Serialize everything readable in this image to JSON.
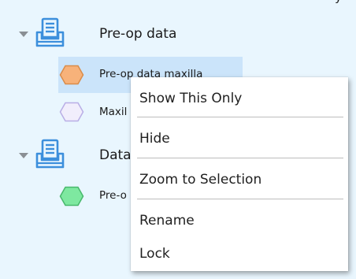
{
  "top_fragment": "y",
  "tree": {
    "groups": [
      {
        "label": "Pre-op data",
        "icon": "tray-icon",
        "items": [
          {
            "label": "Pre-op data maxilla",
            "icon": "hexagon-icon",
            "color": "#f7b27a",
            "stroke": "#d98c4a",
            "selected": true
          },
          {
            "label": "Maxil",
            "icon": "hexagon-icon",
            "color": "#f1eefc",
            "stroke": "#b9aee6",
            "selected": false
          }
        ]
      },
      {
        "label": "Data",
        "icon": "tray-icon",
        "items": [
          {
            "label": "Pre-o",
            "icon": "hexagon-icon",
            "color": "#7ee8a0",
            "stroke": "#48b86c",
            "selected": false
          }
        ]
      }
    ]
  },
  "context_menu": {
    "items": [
      {
        "label": "Show This Only"
      },
      {
        "label": "Hide"
      },
      {
        "label": "Zoom to Selection"
      },
      {
        "label": "Rename"
      },
      {
        "label": "Lock"
      }
    ]
  },
  "colors": {
    "background": "#e9f6fe",
    "selection": "#cbe4fa",
    "icon_blue": "#3c8fdc",
    "menu_bg": "#ffffff"
  }
}
